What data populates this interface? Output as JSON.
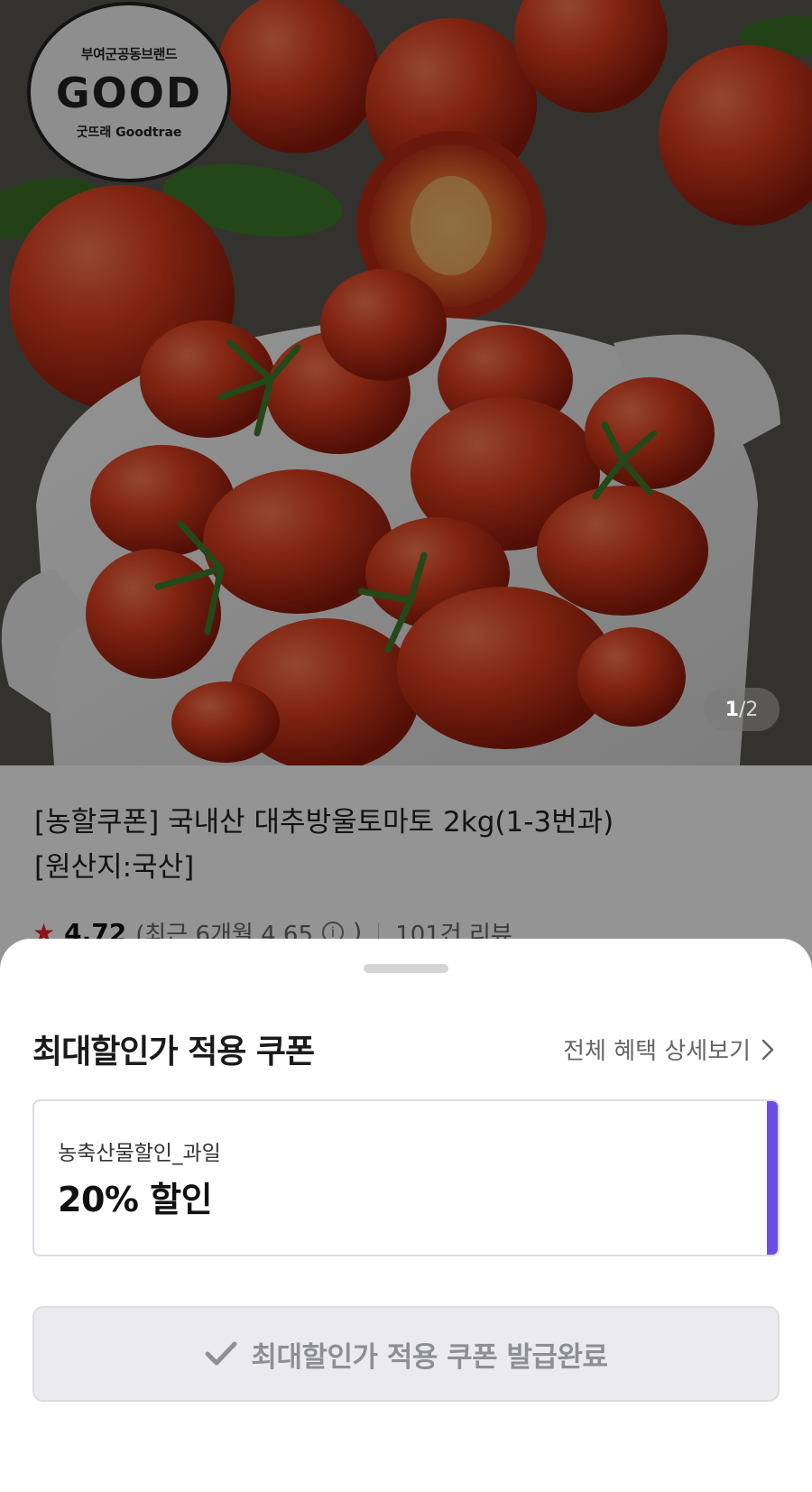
{
  "hero": {
    "brand_badge": {
      "top_text": "부여군공동브랜드",
      "logo_text": "GOOD",
      "bottom_text": "굿뜨래 Goodtrae"
    },
    "image_counter": {
      "current": "1",
      "separator": "/",
      "total": "2"
    }
  },
  "product": {
    "title_line1": "[농할쿠폰] 국내산 대추방울토마토 2kg(1-3번과)",
    "title_line2": "[원산지:국산]",
    "rating_star": "★",
    "rating": "4.72",
    "recent_rating_prefix": "(최근 6개월 4.65",
    "recent_rating_suffix": ")",
    "review_count": "101건 리뷰"
  },
  "sheet": {
    "title": "최대할인가 적용 쿠폰",
    "benefit_link_label": "전체 혜택 상세보기",
    "coupon": {
      "name": "농축산물할인_과일",
      "discount": "20% 할인"
    },
    "issue_button_label": "최대할인가 적용 쿠폰 발급완료"
  },
  "colors": {
    "coupon_accent": "#6b4de6",
    "rating_star": "#f0232e",
    "tomato": "#c8301c",
    "button_bg": "#ebebef"
  },
  "icons": [
    "chevron-right-icon",
    "check-icon",
    "info-icon",
    "star-icon"
  ]
}
